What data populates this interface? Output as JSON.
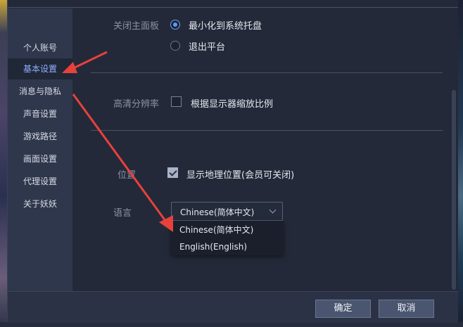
{
  "sidebar": {
    "items": [
      {
        "label": "个人账号"
      },
      {
        "label": "基本设置"
      },
      {
        "label": "消息与隐私"
      },
      {
        "label": "声音设置"
      },
      {
        "label": "游戏路径"
      },
      {
        "label": "画面设置"
      },
      {
        "label": "代理设置"
      },
      {
        "label": "关于妖妖"
      }
    ],
    "active": "基本设置"
  },
  "settings": {
    "close_panel": {
      "label": "关闭主面板",
      "options": [
        {
          "label": "最小化到系统托盘",
          "selected": true
        },
        {
          "label": "退出平台",
          "selected": false
        }
      ]
    },
    "hd_resolution": {
      "label": "高清分辨率",
      "checkbox_label": "根据显示器缩放比例",
      "checked": false
    },
    "location": {
      "label": "位置",
      "checkbox_label": "显示地理位置(会员可关闭)",
      "checked": true
    },
    "language": {
      "label": "语言",
      "selected": "Chinese(简体中文)",
      "options": [
        "Chinese(简体中文)",
        "English(English)"
      ]
    }
  },
  "footer": {
    "confirm_label": "确定",
    "cancel_label": "取消"
  },
  "colors": {
    "accent": "#5c9bff",
    "arrow": "#e8413c"
  }
}
